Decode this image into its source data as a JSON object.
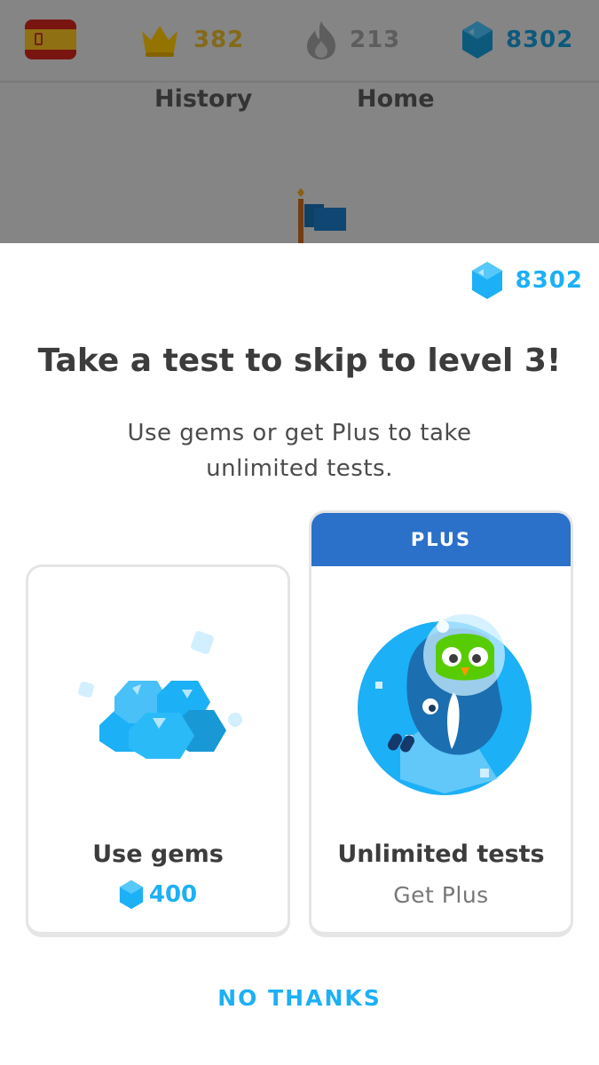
{
  "topbar": {
    "language_flag": "spain-flag-icon",
    "crowns": "382",
    "streak": "213",
    "gems": "8302"
  },
  "nav_tabs": [
    "History",
    "Home"
  ],
  "sheet": {
    "gems": "8302",
    "title": "Take a test to skip to level 3!",
    "subtitle": "Use gems or get Plus to take unlimited tests.",
    "gems_option": {
      "title": "Use gems",
      "cost": "400"
    },
    "plus_option": {
      "badge": "PLUS",
      "title": "Unlimited tests",
      "action": "Get Plus"
    },
    "dismiss_label": "NO THANKS"
  },
  "colors": {
    "accent_blue": "#1cb0f6",
    "plus_blue": "#2b70c9",
    "crown_gold": "#ffc800",
    "title_text": "#3c3c3c"
  }
}
